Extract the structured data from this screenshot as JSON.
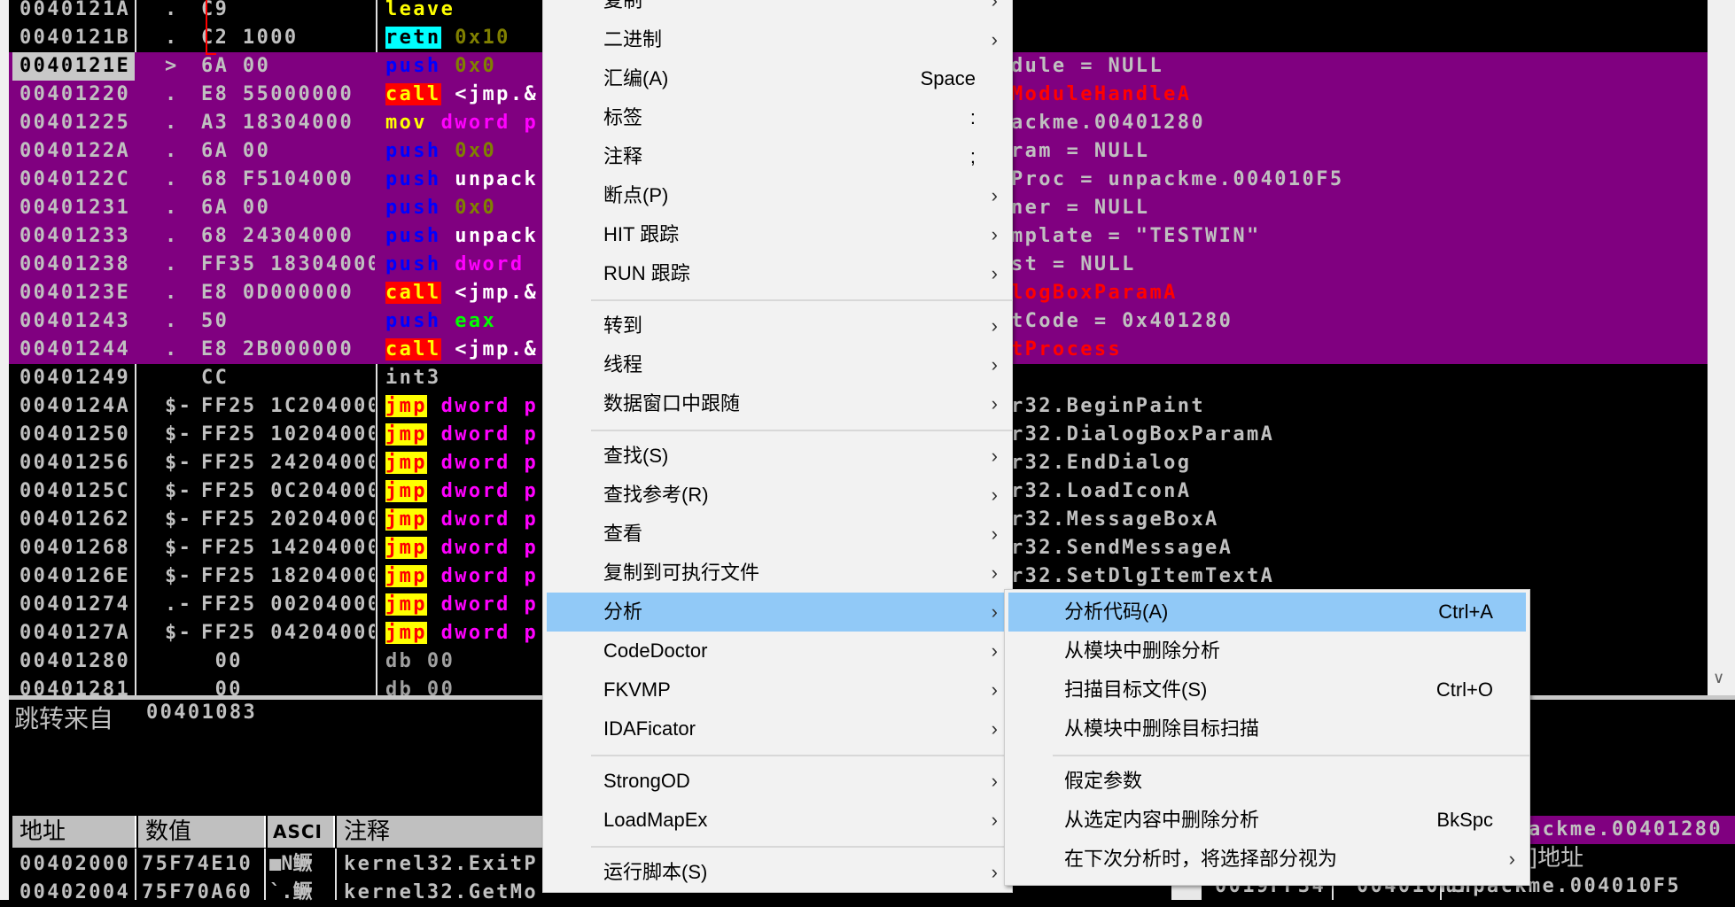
{
  "colors": {
    "highlight_row": "#800080",
    "menu_highlight": "#91c9f7",
    "menu_bg": "#f2f2f2"
  },
  "disasm": {
    "jump_arrow_icon": "red-jump-arrow",
    "rows": [
      {
        "addr": "0040121A",
        "mark": ".",
        "hex": "C9",
        "ins": [
          {
            "t": "leave",
            "k": "leave"
          }
        ],
        "cmt": "",
        "hl": false
      },
      {
        "addr": "0040121B",
        "mark": ".",
        "hex": "C2 1000",
        "ins": [
          {
            "t": "retn",
            "k": "retn"
          },
          {
            "t": " 0x10",
            "k": "num"
          }
        ],
        "cmt": "",
        "hl": false
      },
      {
        "addr": "0040121E",
        "mark": ">",
        "hex": "6A 00",
        "ins": [
          {
            "t": "push",
            "k": "push"
          },
          {
            "t": " 0x0",
            "k": "num"
          }
        ],
        "cmt": "dule = NULL",
        "hl": true,
        "cur": true
      },
      {
        "addr": "00401220",
        "mark": ".",
        "hex": "E8 55000000",
        "ins": [
          {
            "t": "call",
            "k": "call"
          },
          {
            "t": " <jmp.&",
            "k": "plain"
          }
        ],
        "cmt": "ModuleHandleA",
        "cmt_red": true,
        "hl": true
      },
      {
        "addr": "00401225",
        "mark": ".",
        "hex": "A3 18304000",
        "ins": [
          {
            "t": "mov",
            "k": "mov"
          },
          {
            "t": " dword p",
            "k": "mem"
          }
        ],
        "cmt": "ackme.00401280",
        "hl": true
      },
      {
        "addr": "0040122A",
        "mark": ".",
        "hex": "6A 00",
        "ins": [
          {
            "t": "push",
            "k": "push"
          },
          {
            "t": " 0x0",
            "k": "num"
          }
        ],
        "cmt": "ram = NULL",
        "hl": true
      },
      {
        "addr": "0040122C",
        "mark": ".",
        "hex": "68 F5104000",
        "ins": [
          {
            "t": "push",
            "k": "push"
          },
          {
            "t": " unpack",
            "k": "plain"
          }
        ],
        "cmt": "Proc = unpackme.004010F5",
        "hl": true
      },
      {
        "addr": "00401231",
        "mark": ".",
        "hex": "6A 00",
        "ins": [
          {
            "t": "push",
            "k": "push"
          },
          {
            "t": " 0x0",
            "k": "num"
          }
        ],
        "cmt": "ner = NULL",
        "hl": true
      },
      {
        "addr": "00401233",
        "mark": ".",
        "hex": "68 24304000",
        "ins": [
          {
            "t": "push",
            "k": "push"
          },
          {
            "t": " unpack",
            "k": "plain"
          }
        ],
        "cmt": "mplate = \"TESTWIN\"",
        "hl": true
      },
      {
        "addr": "00401238",
        "mark": ".",
        "hex": "FF35 18304000",
        "ins": [
          {
            "t": "push",
            "k": "push"
          },
          {
            "t": " dword",
            "k": "mem"
          }
        ],
        "cmt": "st = NULL",
        "hl": true
      },
      {
        "addr": "0040123E",
        "mark": ".",
        "hex": "E8 0D000000",
        "ins": [
          {
            "t": "call",
            "k": "call"
          },
          {
            "t": " <jmp.&",
            "k": "plain"
          }
        ],
        "cmt": "logBoxParamA",
        "cmt_red": true,
        "hl": true
      },
      {
        "addr": "00401243",
        "mark": ".",
        "hex": "50",
        "ins": [
          {
            "t": "push",
            "k": "push"
          },
          {
            "t": " eax",
            "k": "reg"
          }
        ],
        "cmt": "tCode = 0x401280",
        "hl": true
      },
      {
        "addr": "00401244",
        "mark": ".",
        "hex": "E8 2B000000",
        "ins": [
          {
            "t": "call",
            "k": "call"
          },
          {
            "t": " <jmp.&",
            "k": "plain"
          }
        ],
        "cmt": "tProcess",
        "cmt_red": true,
        "hl": true
      },
      {
        "addr": "00401249",
        "mark": "",
        "hex": "CC",
        "ins": [
          {
            "t": "int3",
            "k": "gray"
          }
        ],
        "cmt": "",
        "hl": false
      },
      {
        "addr": "0040124A",
        "mark": "$-",
        "hex": "FF25 1C204000",
        "ins": [
          {
            "t": "jmp",
            "k": "jmp"
          },
          {
            "t": " dword p",
            "k": "mem"
          }
        ],
        "cmt": "r32.BeginPaint",
        "hl": false
      },
      {
        "addr": "00401250",
        "mark": "$-",
        "hex": "FF25 10204000",
        "ins": [
          {
            "t": "jmp",
            "k": "jmp"
          },
          {
            "t": " dword p",
            "k": "mem"
          }
        ],
        "cmt": "r32.DialogBoxParamA",
        "hl": false
      },
      {
        "addr": "00401256",
        "mark": "$-",
        "hex": "FF25 24204000",
        "ins": [
          {
            "t": "jmp",
            "k": "jmp"
          },
          {
            "t": " dword p",
            "k": "mem"
          }
        ],
        "cmt": "r32.EndDialog",
        "hl": false
      },
      {
        "addr": "0040125C",
        "mark": "$-",
        "hex": "FF25 0C204000",
        "ins": [
          {
            "t": "jmp",
            "k": "jmp"
          },
          {
            "t": " dword p",
            "k": "mem"
          }
        ],
        "cmt": "r32.LoadIconA",
        "hl": false
      },
      {
        "addr": "00401262",
        "mark": "$-",
        "hex": "FF25 20204000",
        "ins": [
          {
            "t": "jmp",
            "k": "jmp"
          },
          {
            "t": " dword p",
            "k": "mem"
          }
        ],
        "cmt": "r32.MessageBoxA",
        "hl": false
      },
      {
        "addr": "00401268",
        "mark": "$-",
        "hex": "FF25 14204000",
        "ins": [
          {
            "t": "jmp",
            "k": "jmp"
          },
          {
            "t": " dword p",
            "k": "mem"
          }
        ],
        "cmt": "r32.SendMessageA",
        "hl": false
      },
      {
        "addr": "0040126E",
        "mark": "$-",
        "hex": "FF25 18204000",
        "ins": [
          {
            "t": "jmp",
            "k": "jmp"
          },
          {
            "t": " dword p",
            "k": "mem"
          }
        ],
        "cmt": "r32.SetDlgItemTextA",
        "hl": false
      },
      {
        "addr": "00401274",
        "mark": ".-",
        "hex": "FF25 00204000",
        "ins": [
          {
            "t": "jmp",
            "k": "jmp"
          },
          {
            "t": " dword p",
            "k": "mem"
          }
        ],
        "cmt": "",
        "hl": false
      },
      {
        "addr": "0040127A",
        "mark": "$-",
        "hex": "FF25 04204000",
        "ins": [
          {
            "t": "jmp",
            "k": "jmp"
          },
          {
            "t": " dword p",
            "k": "mem"
          }
        ],
        "cmt": "",
        "hl": false
      },
      {
        "addr": "00401280",
        "mark": "",
        "hex": " 00",
        "ins": [
          {
            "t": "db 00",
            "k": "db"
          }
        ],
        "cmt": "",
        "hl": false
      },
      {
        "addr": "00401281",
        "mark": "",
        "hex": " 00",
        "ins": [
          {
            "t": "db 00",
            "k": "db"
          }
        ],
        "cmt": "",
        "hl": false
      }
    ]
  },
  "info": {
    "label": "跳转来自",
    "address": "00401083"
  },
  "dump": {
    "headers": [
      "地址",
      "数值",
      "ASCI",
      "注释"
    ],
    "rows": [
      [
        "00402000",
        "75F74E10",
        "■N鳜",
        "kernel32.ExitP"
      ],
      [
        "00402004",
        "75F70A60",
        "`.鳜",
        "kernel32.GetMo"
      ]
    ]
  },
  "stack": {
    "rows": [
      "ackme.00401280",
      "]地址"
    ],
    "last_row": [
      "0019FF34",
      "004010F5",
      "unpackme.004010F5"
    ]
  },
  "scrollbar": {
    "down_icon": "chevron-down-icon",
    "down_glyph": "∨"
  },
  "context_menu": {
    "arrow_glyph": "›",
    "items": [
      {
        "label": "复制",
        "arrow": true
      },
      {
        "label": "二进制",
        "arrow": true
      },
      {
        "label": "汇编(A)",
        "shortcut": "Space"
      },
      {
        "label": "标签",
        "shortcut": ":"
      },
      {
        "label": "注释",
        "shortcut": ";"
      },
      {
        "label": "断点(P)",
        "arrow": true
      },
      {
        "label": "HIT 跟踪",
        "arrow": true
      },
      {
        "label": "RUN 跟踪",
        "arrow": true
      },
      {
        "sep": true
      },
      {
        "label": "转到",
        "arrow": true
      },
      {
        "label": "线程",
        "arrow": true
      },
      {
        "label": "数据窗口中跟随",
        "arrow": true
      },
      {
        "sep": true
      },
      {
        "label": "查找(S)",
        "arrow": true
      },
      {
        "label": "查找参考(R)",
        "arrow": true
      },
      {
        "label": "查看",
        "arrow": true
      },
      {
        "label": "复制到可执行文件",
        "arrow": true
      },
      {
        "label": "分析",
        "arrow": true,
        "highlighted": true
      },
      {
        "label": "CodeDoctor",
        "arrow": true
      },
      {
        "label": "FKVMP",
        "arrow": true
      },
      {
        "label": "IDAFicator",
        "arrow": true
      },
      {
        "sep": true
      },
      {
        "label": "StrongOD",
        "arrow": true
      },
      {
        "label": "LoadMapEx",
        "arrow": true
      },
      {
        "sep": true
      },
      {
        "label": "运行脚本(S)",
        "arrow": true
      }
    ]
  },
  "submenu": {
    "items": [
      {
        "label": "分析代码(A)",
        "shortcut": "Ctrl+A",
        "highlighted": true
      },
      {
        "label": "从模块中删除分析"
      },
      {
        "label": "扫描目标文件(S)",
        "shortcut": "Ctrl+O"
      },
      {
        "label": "从模块中删除目标扫描"
      },
      {
        "sep": true
      },
      {
        "label": "假定参数"
      },
      {
        "label": "从选定内容中删除分析",
        "shortcut": "BkSpc"
      },
      {
        "label": "在下次分析时，将选择部分视为",
        "arrow": true
      }
    ]
  }
}
